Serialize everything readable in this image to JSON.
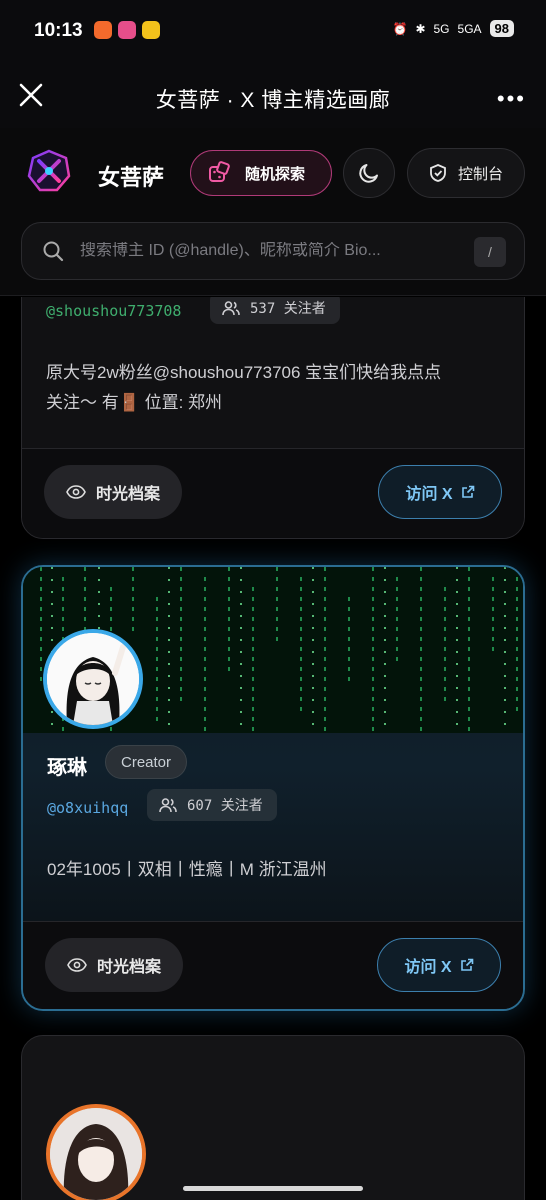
{
  "status_bar": {
    "time": "10:13",
    "signal1": "5G",
    "signal2": "5GA",
    "battery": "98"
  },
  "titlebar": {
    "title": "女菩萨 · X 博主精选画廊"
  },
  "header": {
    "brand": "女菩萨",
    "random_label": "随机探索",
    "console_label": "控制台",
    "search_placeholder": "搜索博主 ID (@handle)、昵称或简介 Bio...",
    "search_shortcut": "/"
  },
  "cards": [
    {
      "handle": "@shoushou773708",
      "followers": "537 关注者",
      "bio_line1": "原大号2w粉丝@shoushou773706 宝宝们快给我点点",
      "bio_line2": "关注～ 有🚪 位置: 郑州",
      "archive_label": "时光档案",
      "visit_label": "访问 X"
    },
    {
      "name": "琢琳",
      "badge": "Creator",
      "handle": "@o8xuihqq",
      "followers": "607 关注者",
      "bio": "02年1005丨双相丨性瘾丨M 浙江温州",
      "archive_label": "时光档案",
      "visit_label": "访问 X"
    }
  ],
  "colors": {
    "accent_pink": "#b03a78",
    "accent_blue": "#3aa8e8",
    "handle_green": "#3fae6e",
    "handle_blue": "#5aa7e0"
  }
}
